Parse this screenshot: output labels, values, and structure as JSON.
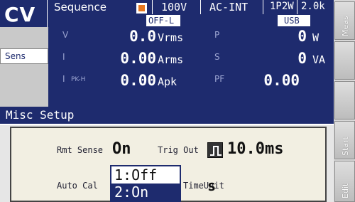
{
  "status": {
    "mode": "CV",
    "sequence": "Sequence",
    "voltage_range": "100V",
    "source": "AC-INT",
    "wiring": "1P2W",
    "current_range": "2.0k",
    "output_state": "OFF-L",
    "interface": "USB"
  },
  "sidebar": {
    "sens": "Sens"
  },
  "softkeys": {
    "meas": "Meas",
    "start": "Start",
    "edit": "Edit"
  },
  "measurements": {
    "v": {
      "label": "V",
      "value": "0.0",
      "unit": "Vrms"
    },
    "i": {
      "label": "I",
      "value": "0.00",
      "unit": "Arms"
    },
    "ipk": {
      "label": "I",
      "sub": "PK-H",
      "value": "0.00",
      "unit": "Apk"
    },
    "p": {
      "label": "P",
      "value": "0",
      "unit": "W"
    },
    "s": {
      "label": "S",
      "value": "0",
      "unit": "VA"
    },
    "pf": {
      "label": "PF",
      "value": "0.00"
    }
  },
  "dialog": {
    "title": "Misc Setup",
    "rmt_sense_label": "Rmt Sense",
    "rmt_sense_value": "On",
    "trig_out_label": "Trig Out",
    "trig_out_value": "10.0ms",
    "auto_cal_label": "Auto Cal",
    "timeunit_label": "TimeUnit",
    "timeunit_value": "s",
    "options": [
      "1:Off",
      "2:On"
    ]
  },
  "colors": {
    "panel": "#1e2b6e",
    "stop": "#e8771f",
    "selection": "#1e2b6e"
  }
}
